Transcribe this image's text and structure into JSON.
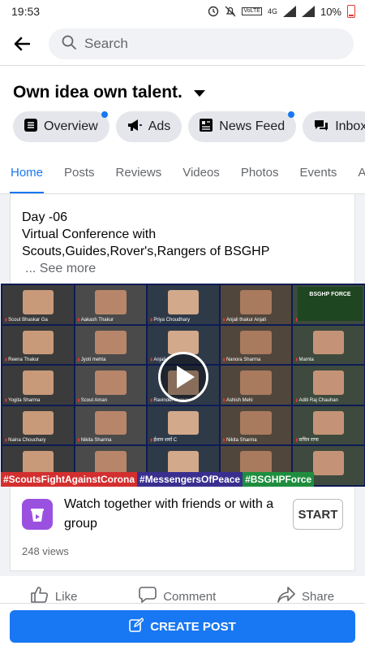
{
  "status_bar": {
    "time": "19:53",
    "network": "4G",
    "battery": "10%"
  },
  "search": {
    "placeholder": "Search"
  },
  "page": {
    "title": "Own idea own talent."
  },
  "pills": [
    {
      "label": "Overview",
      "icon": "overview-icon",
      "badge": true
    },
    {
      "label": "Ads",
      "icon": "megaphone-icon",
      "badge": false
    },
    {
      "label": "News Feed",
      "icon": "news-feed-icon",
      "badge": true
    },
    {
      "label": "Inbox",
      "icon": "chat-icon",
      "badge": false
    }
  ],
  "tabs": [
    "Home",
    "Posts",
    "Reviews",
    "Videos",
    "Photos",
    "Events",
    "A"
  ],
  "active_tab": "Home",
  "post": {
    "line1": "Day -06",
    "line2": "Virtual Conference with",
    "line3": "Scouts,Guides,Rover's,Rangers of BSGHP",
    "see_more": "... See more",
    "video": {
      "participants": [
        "Scout Bhaskar Ga",
        "Aakash Thakur",
        "Priya Choudhary",
        "Anjali thakur Anjali",
        "Harit Khosla",
        "Reena Thakur",
        "Jyoti mehta",
        "Anjali",
        "Nanora Sharma",
        "Mamta",
        "Yogita Sharma",
        "Scout Aman",
        "Ravinder Kumar",
        "Ashish Mehi",
        "Aditi Raj Chauhan",
        "Naina Chouchary",
        "Nikita Sharma",
        "ईशान शर्मा C",
        "Nikita Sharma",
        "सचिन राणा",
        "",
        "",
        "",
        "",
        ""
      ],
      "badge_text": "BSGHP FORCE",
      "hashtags": [
        "#ScoutsFightAgainstCorona",
        "#MessengersOfPeace",
        "#BSGHPForce"
      ]
    },
    "watch_text": "Watch together with friends or with a group",
    "start_label": "START",
    "views": "248 views"
  },
  "actions": {
    "like": "Like",
    "comment": "Comment",
    "share": "Share"
  },
  "create_post": "CREATE POST",
  "colors": {
    "accent": "#1877f2",
    "pill_bg": "#e4e6eb",
    "watch_icon": "#9b51e0"
  }
}
